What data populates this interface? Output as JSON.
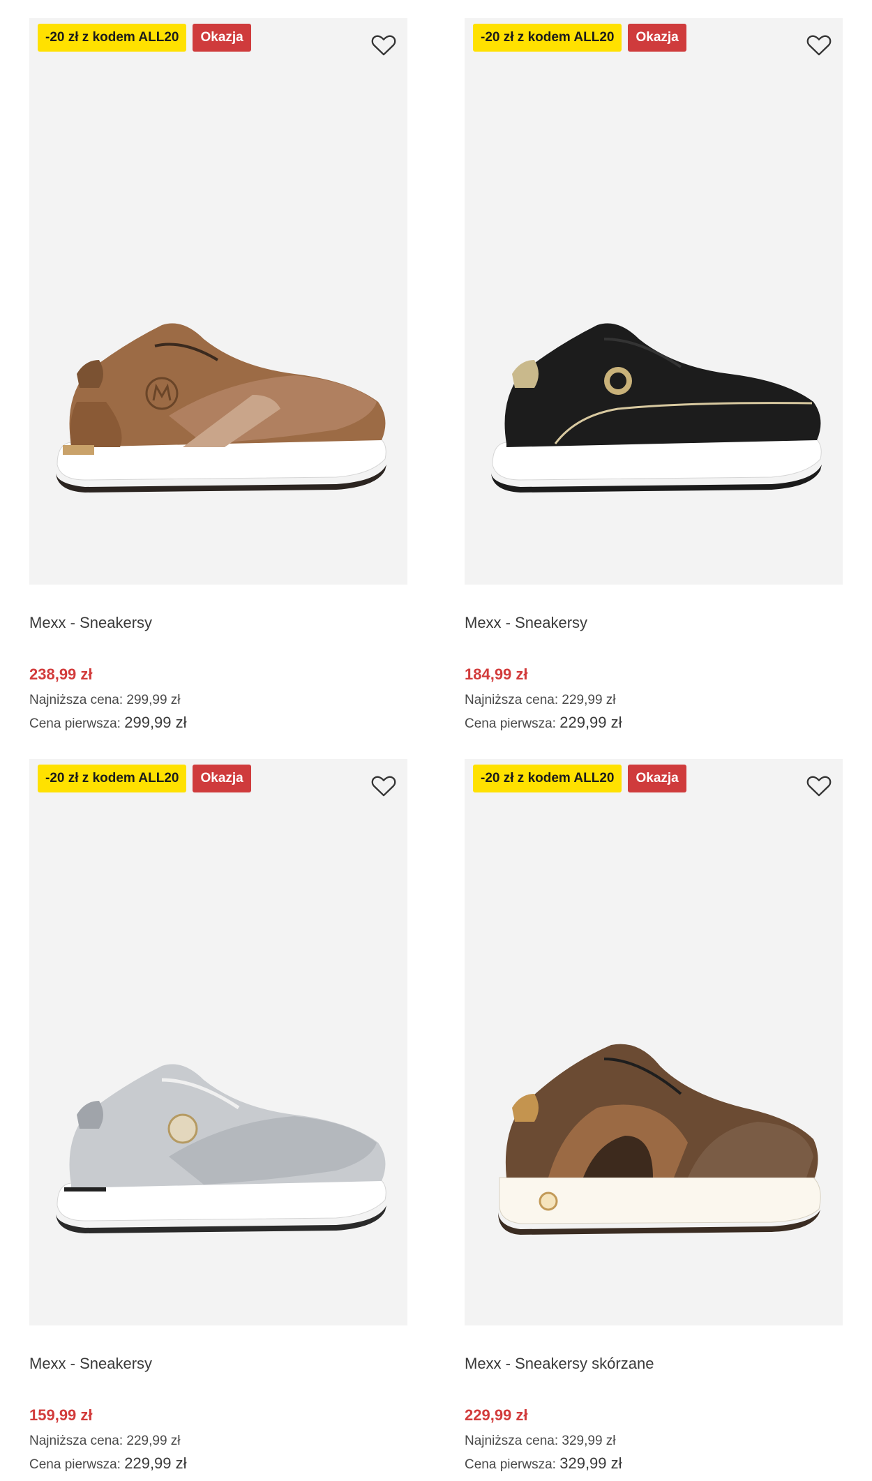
{
  "products": [
    {
      "promo_badge": "-20 zł z kodem ALL20",
      "deal_badge": "Okazja",
      "name": "Mexx - Sneakersy",
      "price": "238,99 zł",
      "lowest_label": "Najniższa cena:",
      "lowest_value": "299,99 zł",
      "first_label": "Cena pierwsza:",
      "first_value": "299,99 zł"
    },
    {
      "promo_badge": "-20 zł z kodem ALL20",
      "deal_badge": "Okazja",
      "name": "Mexx - Sneakersy",
      "price": "184,99 zł",
      "lowest_label": "Najniższa cena:",
      "lowest_value": "229,99 zł",
      "first_label": "Cena pierwsza:",
      "first_value": "229,99 zł"
    },
    {
      "promo_badge": "-20 zł z kodem ALL20",
      "deal_badge": "Okazja",
      "name": "Mexx - Sneakersy",
      "price": "159,99 zł",
      "lowest_label": "Najniższa cena:",
      "lowest_value": "229,99 zł",
      "first_label": "Cena pierwsza:",
      "first_value": "229,99 zł"
    },
    {
      "promo_badge": "-20 zł z kodem ALL20",
      "deal_badge": "Okazja",
      "name": "Mexx - Sneakersy skórzane",
      "price": "229,99 zł",
      "lowest_label": "Najniższa cena:",
      "lowest_value": "329,99 zł",
      "first_label": "Cena pierwsza:",
      "first_value": "329,99 zł"
    }
  ],
  "colors": {
    "promo_badge_bg": "#ffe100",
    "deal_badge_bg": "#cf3b3c",
    "price": "#d23b3b",
    "image_bg": "#f3f3f3"
  },
  "icons": {
    "favorite": "heart-outline-icon"
  }
}
